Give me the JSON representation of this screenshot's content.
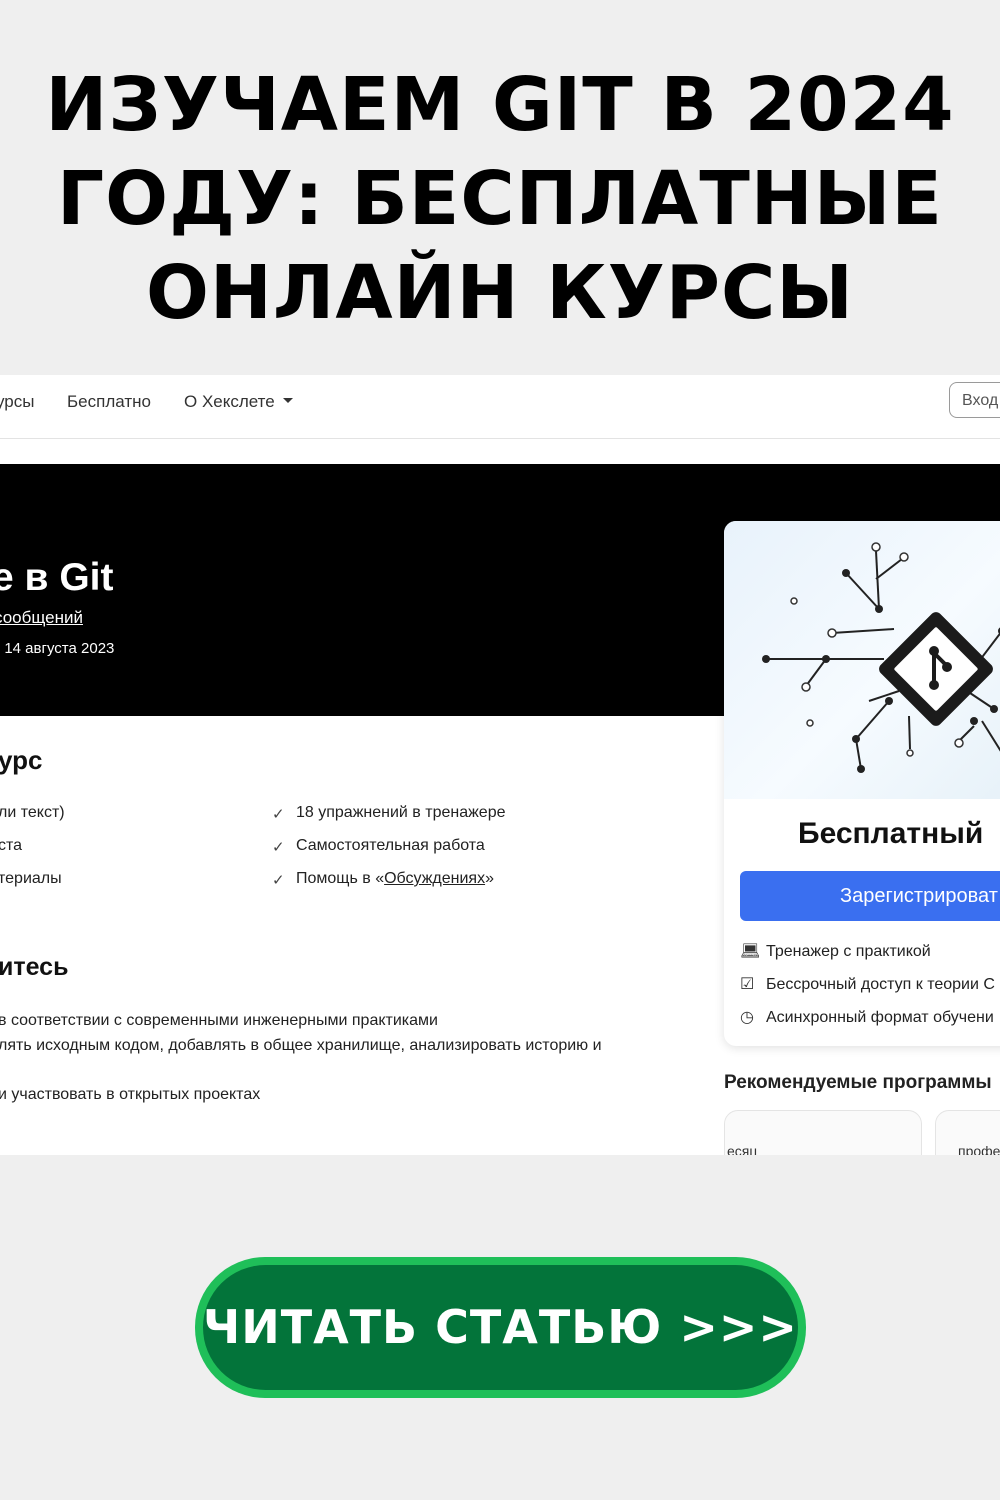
{
  "headline": {
    "line1": "ИЗУЧАЕМ GIT В 2024",
    "line2": "ГОДУ: БЕСПЛАТНЫЕ",
    "line3": "ОНЛАЙН КУРСЫ"
  },
  "navbar": {
    "items": [
      "урсы",
      "Бесплатно",
      "О Хекслете"
    ],
    "login_label": "Вход"
  },
  "hero": {
    "title": "е в Git",
    "link": "сообщений",
    "date": ": 14 августа 2023"
  },
  "course": {
    "title": "урс",
    "left_features": [
      "ли текст)",
      "ста",
      "териалы"
    ],
    "right_features": [
      "18 упражнений в тренажере",
      "Самостоятельная работа"
    ],
    "help_prefix": "Помощь в «",
    "help_link": "Обсуждениях",
    "help_suffix": "»"
  },
  "learn": {
    "title": "итесь",
    "lines": [
      "в соответствии с современными инженерными практиками",
      "лять исходным кодом, добавлять в общее хранилище, анализировать историю и",
      "и участвовать в открытых проектах"
    ]
  },
  "card": {
    "price": "Бесплатный",
    "register_label": "Зарегистрироват",
    "features": [
      {
        "icon": "laptop-icon",
        "label": "Тренажер с практикой"
      },
      {
        "icon": "checkbox-icon",
        "label": "Бессрочный доступ к теории С"
      },
      {
        "icon": "clock-icon",
        "label": "Асинхронный формат обучени"
      }
    ]
  },
  "recommended": {
    "title": "Рекомендуемые программы",
    "items": [
      "есяц",
      "профе"
    ]
  },
  "cta": {
    "label": "ЧИТАТЬ СТАТЬЮ >>>"
  },
  "colors": {
    "page_bg": "#efefef",
    "hero_bg": "#000000",
    "register_button": "#3a6ff0",
    "cta_outer": "#1fbf59",
    "cta_inner": "#03743a"
  }
}
